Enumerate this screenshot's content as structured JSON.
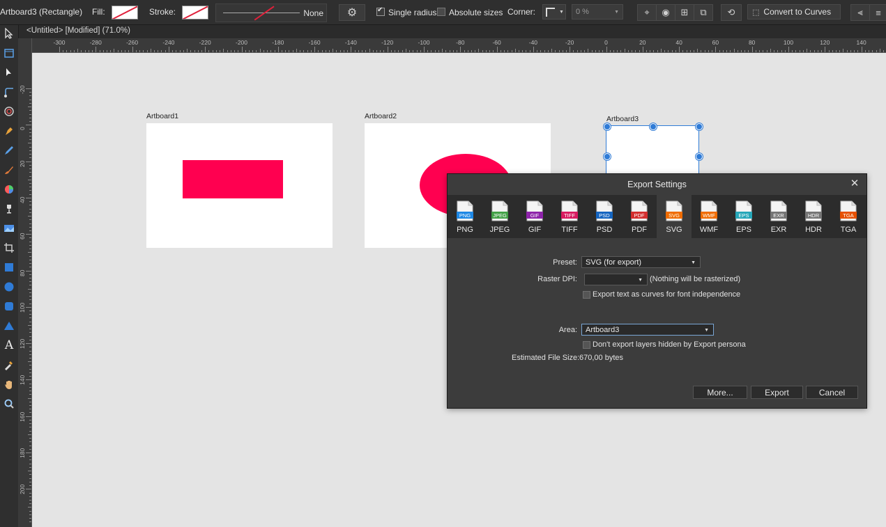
{
  "context_toolbar": {
    "selection_title": "Artboard3 (Rectangle)",
    "fill_label": "Fill:",
    "stroke_label": "Stroke:",
    "stroke_width_value": "None",
    "single_radius_label": "Single radius",
    "single_radius_checked": true,
    "absolute_sizes_label": "Absolute sizes",
    "absolute_sizes_checked": false,
    "corner_label": "Corner:",
    "corner_value": "0 %",
    "convert_label": "Convert to Curves"
  },
  "document_tab": {
    "title": "<Untitled> [Modified] (71.0%)"
  },
  "tools": [
    {
      "icon": "move-tool-icon"
    },
    {
      "icon": "artboard-tool-icon"
    },
    {
      "icon": "node-tool-icon"
    },
    {
      "icon": "corner-tool-icon"
    },
    {
      "icon": "point-transform-icon"
    },
    {
      "icon": "pen-tool-icon"
    },
    {
      "icon": "pencil-tool-icon"
    },
    {
      "icon": "vector-brush-icon"
    },
    {
      "icon": "fill-tool-icon"
    },
    {
      "icon": "transparency-tool-icon"
    },
    {
      "icon": "place-image-icon"
    },
    {
      "icon": "crop-tool-icon"
    },
    {
      "icon": "rectangle-tool-icon"
    },
    {
      "icon": "ellipse-tool-icon"
    },
    {
      "icon": "rounded-rectangle-icon"
    },
    {
      "icon": "triangle-tool-icon"
    },
    {
      "icon": "text-tool-icon"
    },
    {
      "icon": "color-picker-icon"
    },
    {
      "icon": "hand-tool-icon"
    },
    {
      "icon": "zoom-tool-icon"
    }
  ],
  "rulers": {
    "unit": "mm",
    "horizontal_ticks": [
      "-300",
      "-280",
      "-260",
      "-240",
      "-220",
      "-200",
      "-180",
      "-160",
      "-140",
      "-120",
      "-100",
      "-80",
      "-60",
      "-40",
      "-20",
      "0",
      "20",
      "40",
      "60",
      "80",
      "100",
      "120",
      "140"
    ],
    "vertical_ticks": [
      "-20",
      "0",
      "20",
      "40",
      "60",
      "80",
      "100",
      "120",
      "140",
      "160",
      "180",
      "200"
    ]
  },
  "canvas": {
    "artboards": [
      {
        "label": "Artboard1",
        "shape": "rectangle",
        "shape_color": "#ff0050"
      },
      {
        "label": "Artboard2",
        "shape": "ellipse",
        "shape_color": "#ff0050"
      },
      {
        "label": "Artboard3",
        "shape": "none",
        "selected": true
      }
    ]
  },
  "export_dialog": {
    "title": "Export Settings",
    "formats": [
      {
        "name": "PNG",
        "badge": "PNG",
        "color": "#1e88e5",
        "selected": false
      },
      {
        "name": "JPEG",
        "badge": "JPEG",
        "color": "#43a047",
        "selected": false
      },
      {
        "name": "GIF",
        "badge": "GIF",
        "color": "#8e24aa",
        "selected": false
      },
      {
        "name": "TIFF",
        "badge": "TIFF",
        "color": "#d81b60",
        "selected": false
      },
      {
        "name": "PSD",
        "badge": "PSD",
        "color": "#1565c0",
        "selected": false
      },
      {
        "name": "PDF",
        "badge": "PDF",
        "color": "#d32f2f",
        "selected": false
      },
      {
        "name": "SVG",
        "badge": "SVG",
        "color": "#ef6c00",
        "selected": true
      },
      {
        "name": "WMF",
        "badge": "WMF",
        "color": "#ef6c00",
        "selected": false
      },
      {
        "name": "EPS",
        "badge": "EPS",
        "color": "#26a6b8",
        "selected": false
      },
      {
        "name": "EXR",
        "badge": "EXR",
        "color": "#757575",
        "selected": false
      },
      {
        "name": "HDR",
        "badge": "HDR",
        "color": "#757575",
        "selected": false
      },
      {
        "name": "TGA",
        "badge": "TGA",
        "color": "#e65100",
        "selected": false
      }
    ],
    "preset_label": "Preset:",
    "preset_value": "SVG (for export)",
    "raster_dpi_label": "Raster DPI:",
    "raster_dpi_value": "",
    "raster_dpi_note": "(Nothing will be rasterized)",
    "text_as_curves_label": "Export text as curves for font independence",
    "text_as_curves_checked": false,
    "area_label": "Area:",
    "area_value": "Artboard3",
    "hidden_layers_label": "Don't export layers hidden by Export persona",
    "hidden_layers_checked": false,
    "file_size_label": "Estimated File Size:",
    "file_size_value": "670,00 bytes",
    "more_button": "More...",
    "export_button": "Export",
    "cancel_button": "Cancel"
  }
}
